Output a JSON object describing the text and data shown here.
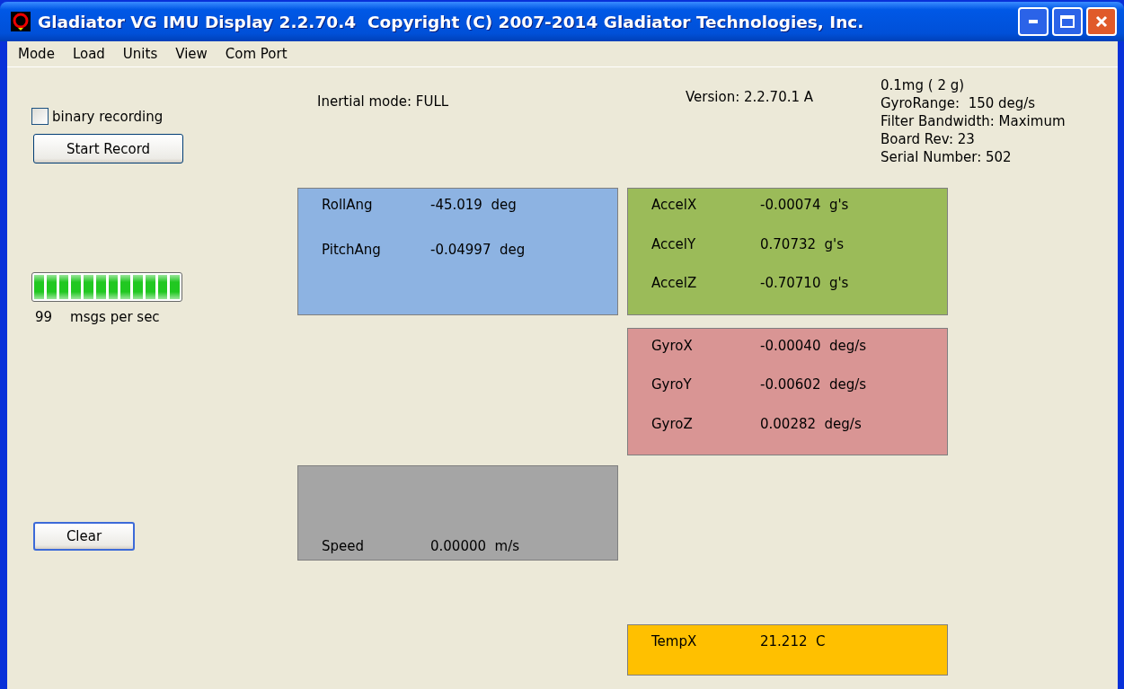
{
  "window": {
    "title": "Gladiator VG IMU Display 2.2.70.4  Copyright (C) 2007-2014 Gladiator Technologies, Inc."
  },
  "menu": [
    "Mode",
    "Load",
    "Units",
    "View",
    "Com Port"
  ],
  "binary_recording": {
    "label": "binary recording",
    "checked": false
  },
  "start_button": "Start Record",
  "rate": {
    "level": 1.0,
    "count": "99",
    "unit": "msgs per sec"
  },
  "clear_button": "Clear",
  "inertial_mode": "Inertial mode: FULL",
  "version": "Version: 2.2.70.1 A",
  "info": [
    "0.1mg ( 2 g)",
    "GyroRange:  150 deg/s",
    "Filter Bandwidth: Maximum",
    "Board Rev: 23",
    "Serial Number: 502"
  ],
  "panels": [
    {
      "color": "#8db3e2",
      "rows": [
        {
          "label": "RollAng",
          "value": "-45.019  deg"
        },
        {
          "label": "PitchAng",
          "value": "-0.04997  deg"
        }
      ]
    },
    {
      "color": "#9bbb59",
      "rows": [
        {
          "label": "AccelX",
          "value": "-0.00074  g's"
        },
        {
          "label": "AccelY",
          "value": "0.70732  g's"
        },
        {
          "label": "AccelZ",
          "value": "-0.70710  g's"
        }
      ]
    },
    {
      "color": "#d99594",
      "rows": [
        {
          "label": "GyroX",
          "value": "-0.00040  deg/s"
        },
        {
          "label": "GyroY",
          "value": "-0.00602  deg/s"
        },
        {
          "label": "GyroZ",
          "value": "0.00282  deg/s"
        }
      ]
    },
    {
      "color": "#a5a5a5",
      "rows": [
        {
          "label": "Speed",
          "value": "0.00000  m/s"
        }
      ]
    },
    {
      "color": "#ffc000",
      "rows": [
        {
          "label": "TempX",
          "value": "21.212  C"
        }
      ]
    }
  ]
}
